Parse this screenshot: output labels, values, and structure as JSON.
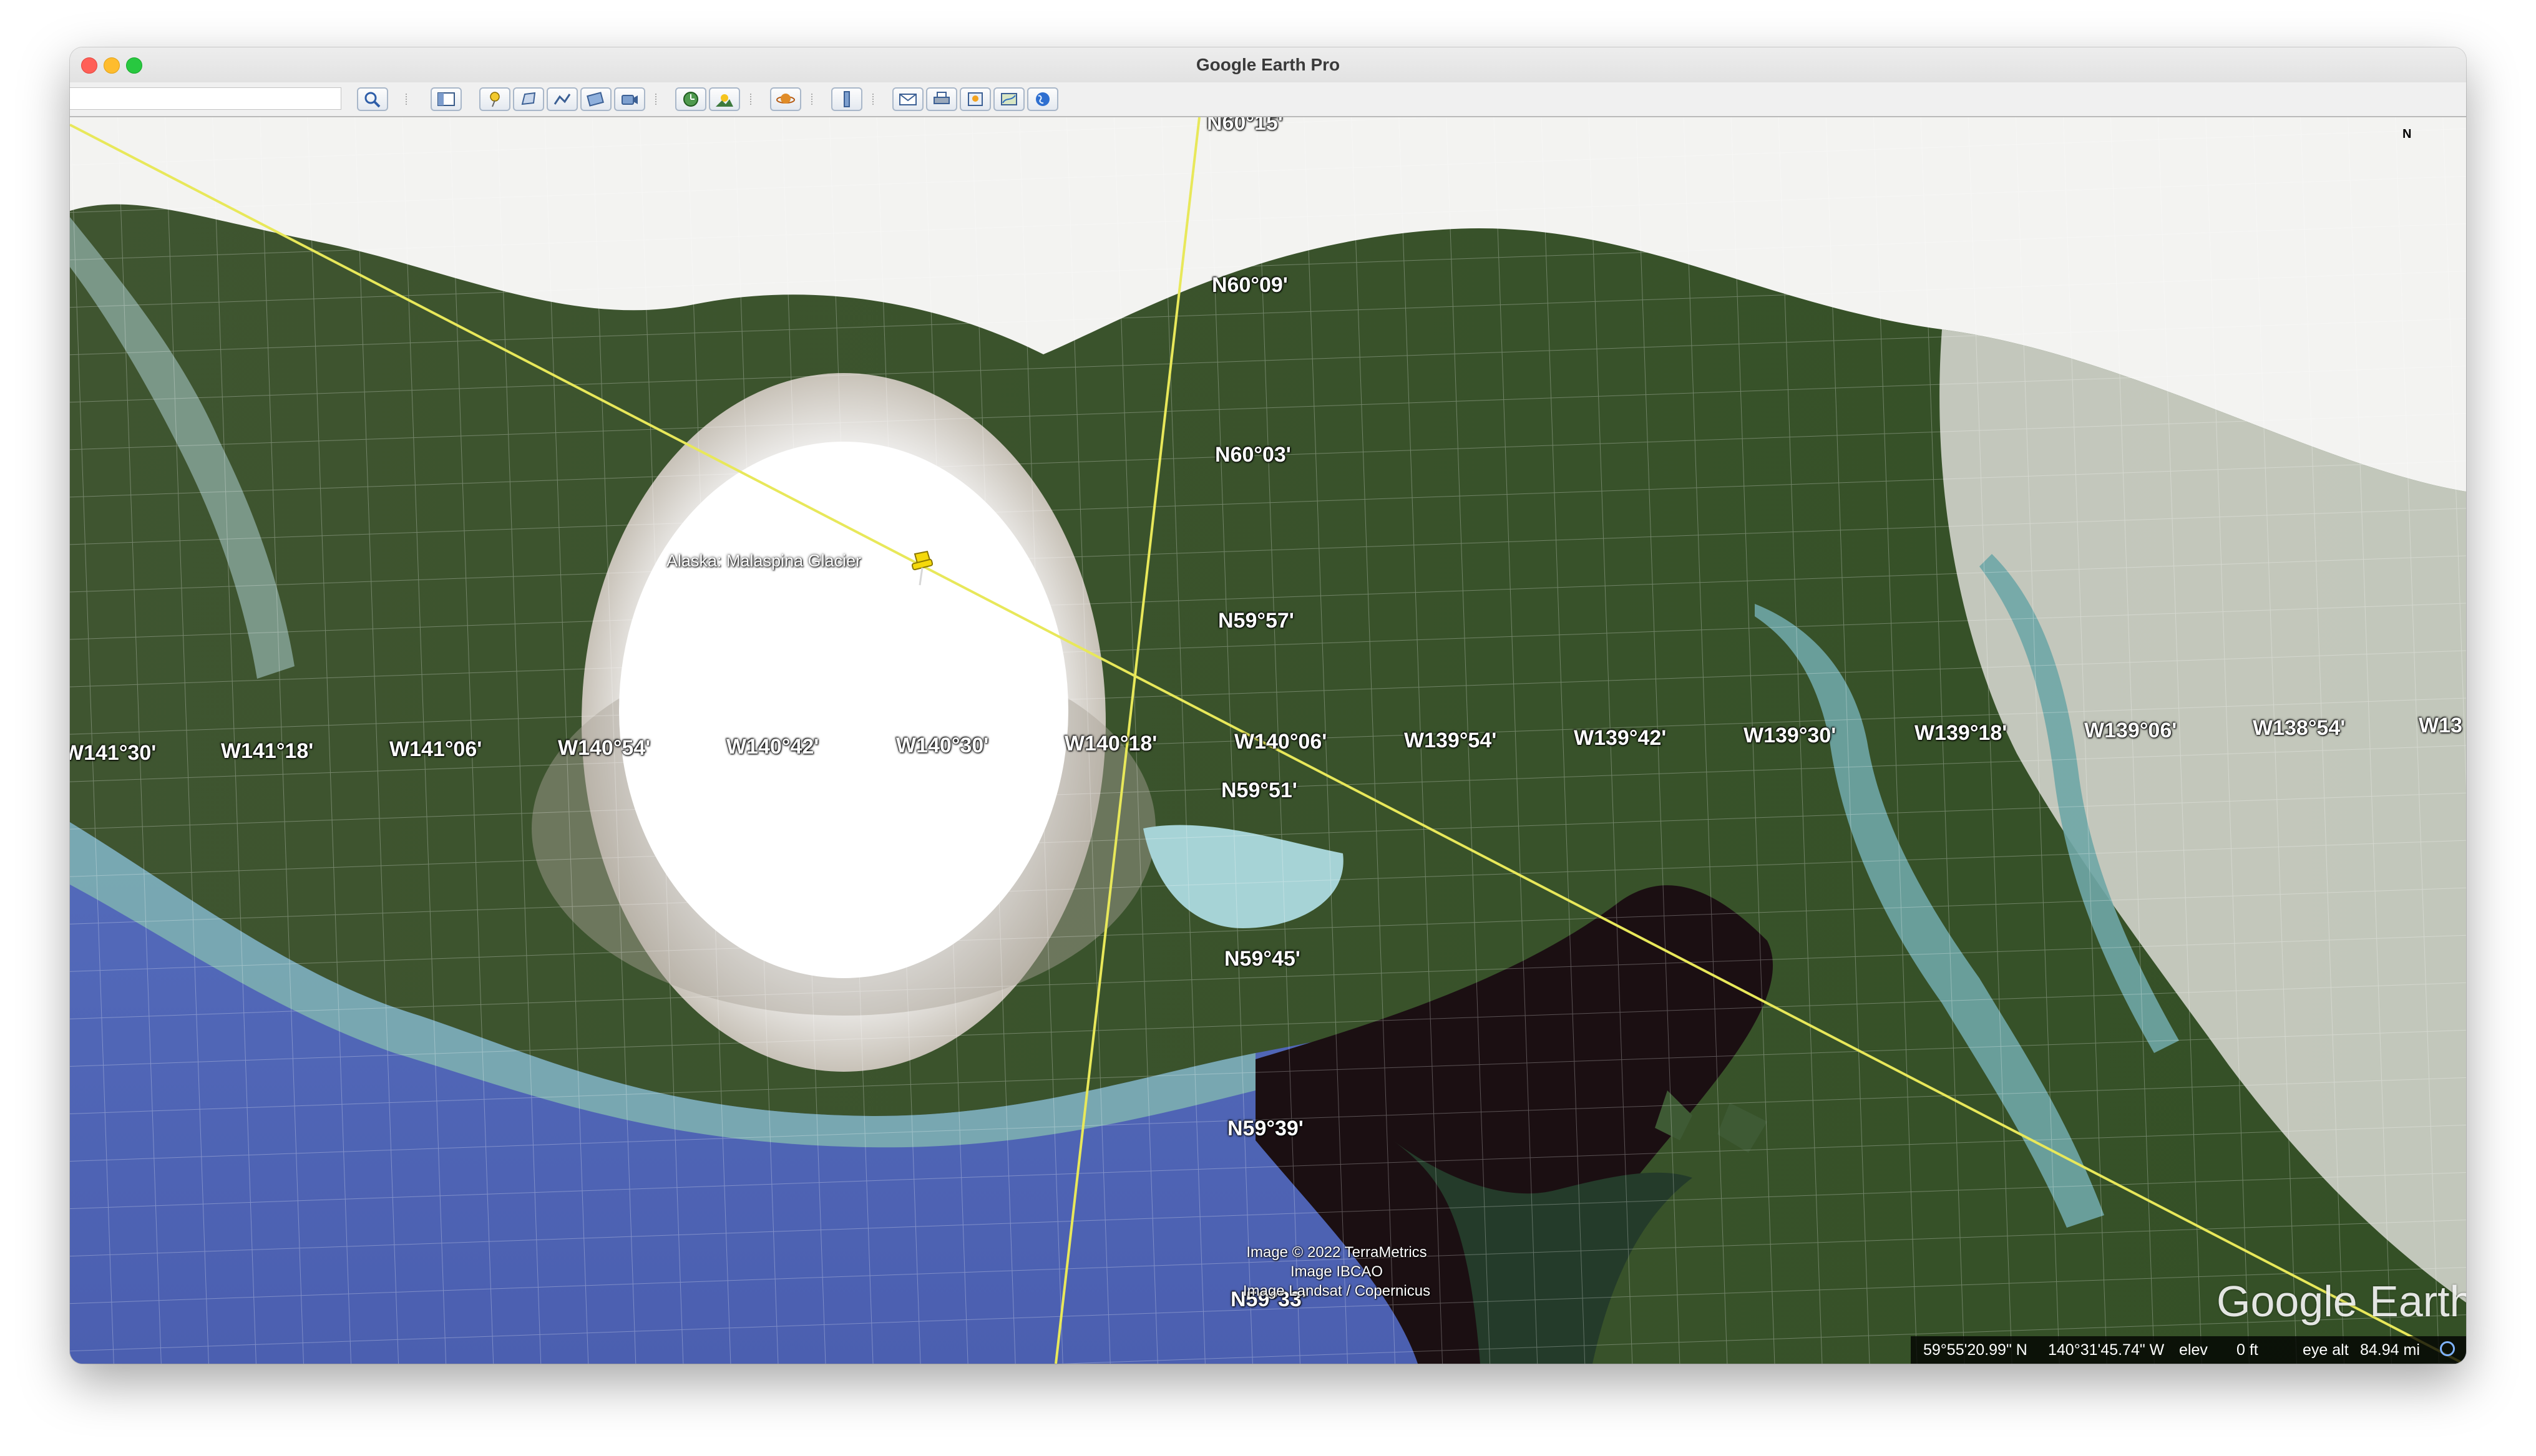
{
  "window": {
    "title": "Google Earth Pro"
  },
  "toolbar": {
    "search_value": "",
    "icons": [
      "search-icon",
      "sidebar-icon",
      "placemark-icon",
      "polygon-icon",
      "path-icon",
      "image-overlay-icon",
      "tour-icon",
      "historical-imagery-icon",
      "sunlight-icon",
      "planets-icon",
      "ruler-icon",
      "email-icon",
      "print-icon",
      "save-image-icon",
      "maps-icon",
      "earth-view-icon"
    ]
  },
  "map": {
    "placemark": {
      "label": "Alaska: Malaspina Glacier",
      "color": "#f5d90a"
    },
    "latitude_labels": [
      "N60°15'",
      "N60°09'",
      "N60°03'",
      "N59°57'",
      "N59°51'",
      "N59°45'",
      "N59°39'",
      "N59°33'"
    ],
    "longitude_labels": [
      "W141°30'",
      "W141°18'",
      "W141°06'",
      "W140°54'",
      "W140°42'",
      "W140°30'",
      "W140°18'",
      "W140°06'",
      "W139°54'",
      "W139°42'",
      "W139°30'",
      "W139°18'",
      "W139°06'",
      "W138°54'",
      "W13"
    ],
    "credits": [
      "Image © 2022 TerraMetrics",
      "Image IBCAO",
      "Image Landsat / Copernicus"
    ],
    "brand": "Google Earth",
    "north_indicator": "N",
    "path_color": "#e8e85a"
  },
  "status": {
    "latitude": "59°55'20.99\" N",
    "longitude": "140°31'45.74\" W",
    "elev_label": "elev",
    "elev_value": "0 ft",
    "eye_alt_label": "eye alt",
    "eye_alt_value": "84.94 mi"
  }
}
